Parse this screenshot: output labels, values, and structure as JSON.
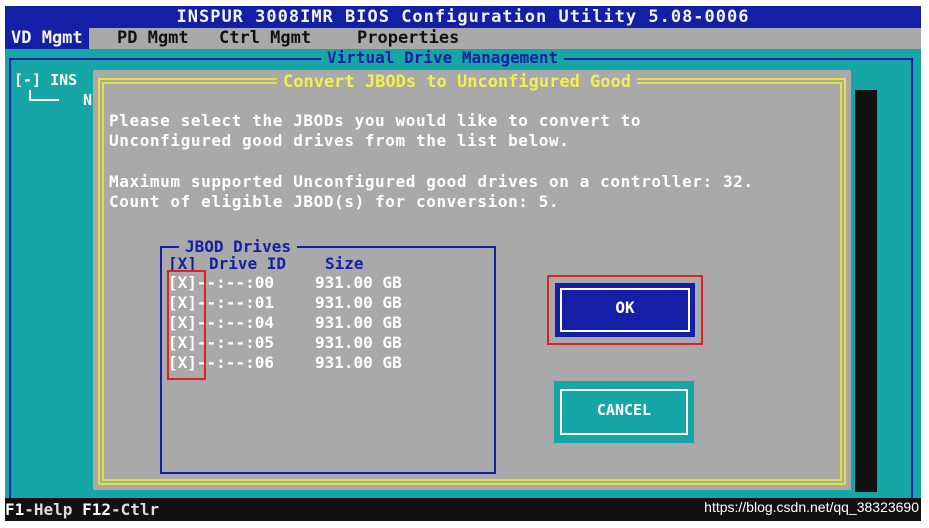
{
  "title": "INSPUR 3008IMR BIOS Configuration Utility 5.08-0006",
  "menu": [
    {
      "label": "VD Mgmt",
      "active": true
    },
    {
      "label": "PD Mgmt",
      "active": false
    },
    {
      "label": "Ctrl Mgmt",
      "active": false
    },
    {
      "label": "Properties",
      "active": false
    }
  ],
  "panel_title": "Virtual Drive Management",
  "tree": {
    "line1": "[-] INS",
    "line2": "N"
  },
  "dialog": {
    "title": "Convert JBODs to Unconfigured Good",
    "message": [
      "Please select the JBODs you would like to convert to",
      "Unconfigured good drives from the list below.",
      "Maximum supported Unconfigured good drives on a controller: 32.",
      "Count of eligible JBOD(s) for conversion: 5."
    ],
    "jbod": {
      "title": "JBOD Drives",
      "headers": {
        "check": "[X]",
        "drive_id": "Drive ID",
        "size": "Size"
      },
      "rows": [
        {
          "check": "[X]",
          "drive_id": "--:--:00",
          "size": "931.00 GB"
        },
        {
          "check": "[X]",
          "drive_id": "--:--:01",
          "size": "931.00 GB"
        },
        {
          "check": "[X]",
          "drive_id": "--:--:04",
          "size": "931.00 GB"
        },
        {
          "check": "[X]",
          "drive_id": "--:--:05",
          "size": "931.00 GB"
        },
        {
          "check": "[X]",
          "drive_id": "--:--:06",
          "size": "931.00 GB"
        }
      ]
    },
    "ok_label": "OK",
    "cancel_label": "CANCEL"
  },
  "status": {
    "f1_key": "F1",
    "f1_text": "-Help ",
    "f12_key": "F12",
    "f12_text": "-Ctlr"
  },
  "watermark": "https://blog.csdn.net/qq_38323690",
  "colors": {
    "bios_blue": "#1320a6",
    "cyan_bg": "#17a6a6",
    "dialog_gray": "#a9a9a9",
    "title_yellow": "#f0f050",
    "highlight_red": "#dd2222"
  }
}
